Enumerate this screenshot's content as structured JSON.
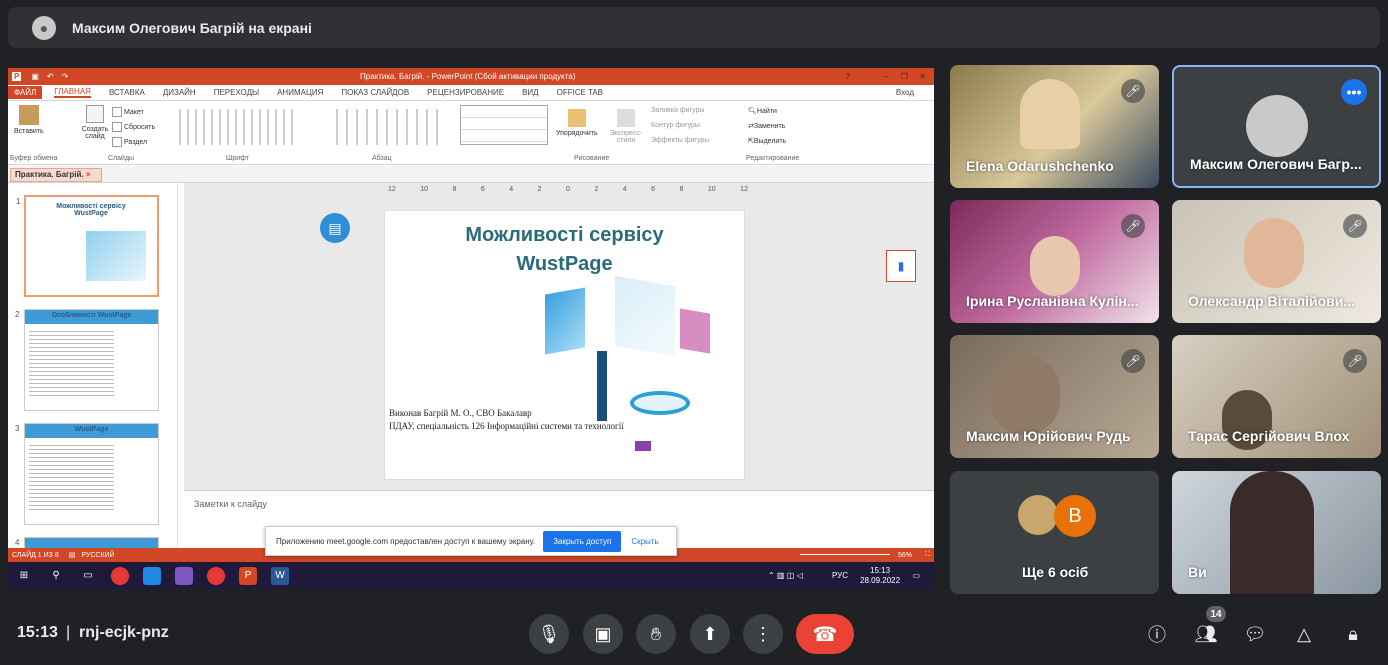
{
  "top_bar": {
    "presenter_title": "Максим Олегович Багрій на екрані"
  },
  "screen": {
    "window_title": "Практика. Багрій. - PowerPoint (Сбой активации продукта)",
    "ribbon_tabs": [
      "ФАЙЛ",
      "ГЛАВНАЯ",
      "ВСТАВКА",
      "ДИЗАЙН",
      "ПЕРЕХОДЫ",
      "АНИМАЦИЯ",
      "ПОКАЗ СЛАЙДОВ",
      "РЕЦЕНЗИРОВАНИЕ",
      "ВИД",
      "OFFICE TAB"
    ],
    "login_label": "Вход",
    "ribbon": {
      "paste": "Вставить",
      "create_slide": "Создать слайд",
      "layout": "Макет",
      "reset": "Сбросить",
      "section": "Раздел",
      "arrange": "Упорядочить",
      "quick_styles": "Экспресс-стили",
      "shape_fill": "Заливка фигуры",
      "shape_outline": "Контур фигуры",
      "shape_effects": "Эффекты фигуры",
      "find": "Найти",
      "replace": "Заменить",
      "select": "Выделить",
      "groups": [
        "Буфер обмена",
        "Слайды",
        "Шрифт",
        "Абзац",
        "Рисование",
        "Редактирование"
      ]
    },
    "doc_tab": "Практика. Багрій.",
    "thumbnails": [
      {
        "num": "1",
        "title": "Можливості сервісу WustPage"
      },
      {
        "num": "2",
        "title": "Особливості WustPage"
      },
      {
        "num": "3",
        "title": "WustPage"
      },
      {
        "num": "4",
        "title": ""
      }
    ],
    "ruler_ticks": [
      "12",
      "10",
      "8",
      "6",
      "4",
      "2",
      "0",
      "2",
      "4",
      "6",
      "8",
      "10",
      "12"
    ],
    "slide": {
      "title_line1": "Можливості сервісу",
      "title_line2": "WustPage",
      "byline1": "Виконав Багрій М. О., СВО Бакалавр",
      "byline2": "ПДАУ, спеціальність 126 Інформаційні системи та технології"
    },
    "notes_placeholder": "Заметки к слайду",
    "status_slide": "СЛАЙД 1 ИЗ 8",
    "status_lang": "РУССКИЙ",
    "zoom": "56%",
    "share_banner": {
      "text": "Приложению meet.google.com предоставлен доступ к вашему экрану.",
      "stop": "Закрыть доступ",
      "hide": "Скрыть"
    },
    "taskbar": {
      "lang": "РУС",
      "time": "15:13",
      "date": "28.09.2022"
    }
  },
  "participants": [
    {
      "name": "Elena Odarushchenko",
      "muted": true
    },
    {
      "name": "Максим Олегович Багр...",
      "muted": false
    },
    {
      "name": "Ірина Русланівна Кулін...",
      "muted": true
    },
    {
      "name": "Олександр Віталійови...",
      "muted": true
    },
    {
      "name": "Максим Юрійович Рудь",
      "muted": true
    },
    {
      "name": "Тарас Сергійович Влох",
      "muted": true
    },
    {
      "name": "Ще 6 осіб",
      "avatar_letter": "В"
    },
    {
      "name": "Ви"
    }
  ],
  "bottom_bar": {
    "time": "15:13",
    "meeting_code": "rnj-ecjk-pnz",
    "participant_count": "14"
  },
  "colors": {
    "end_call": "#ea4335",
    "accent": "#1a73e8",
    "ppt": "#d24726"
  }
}
